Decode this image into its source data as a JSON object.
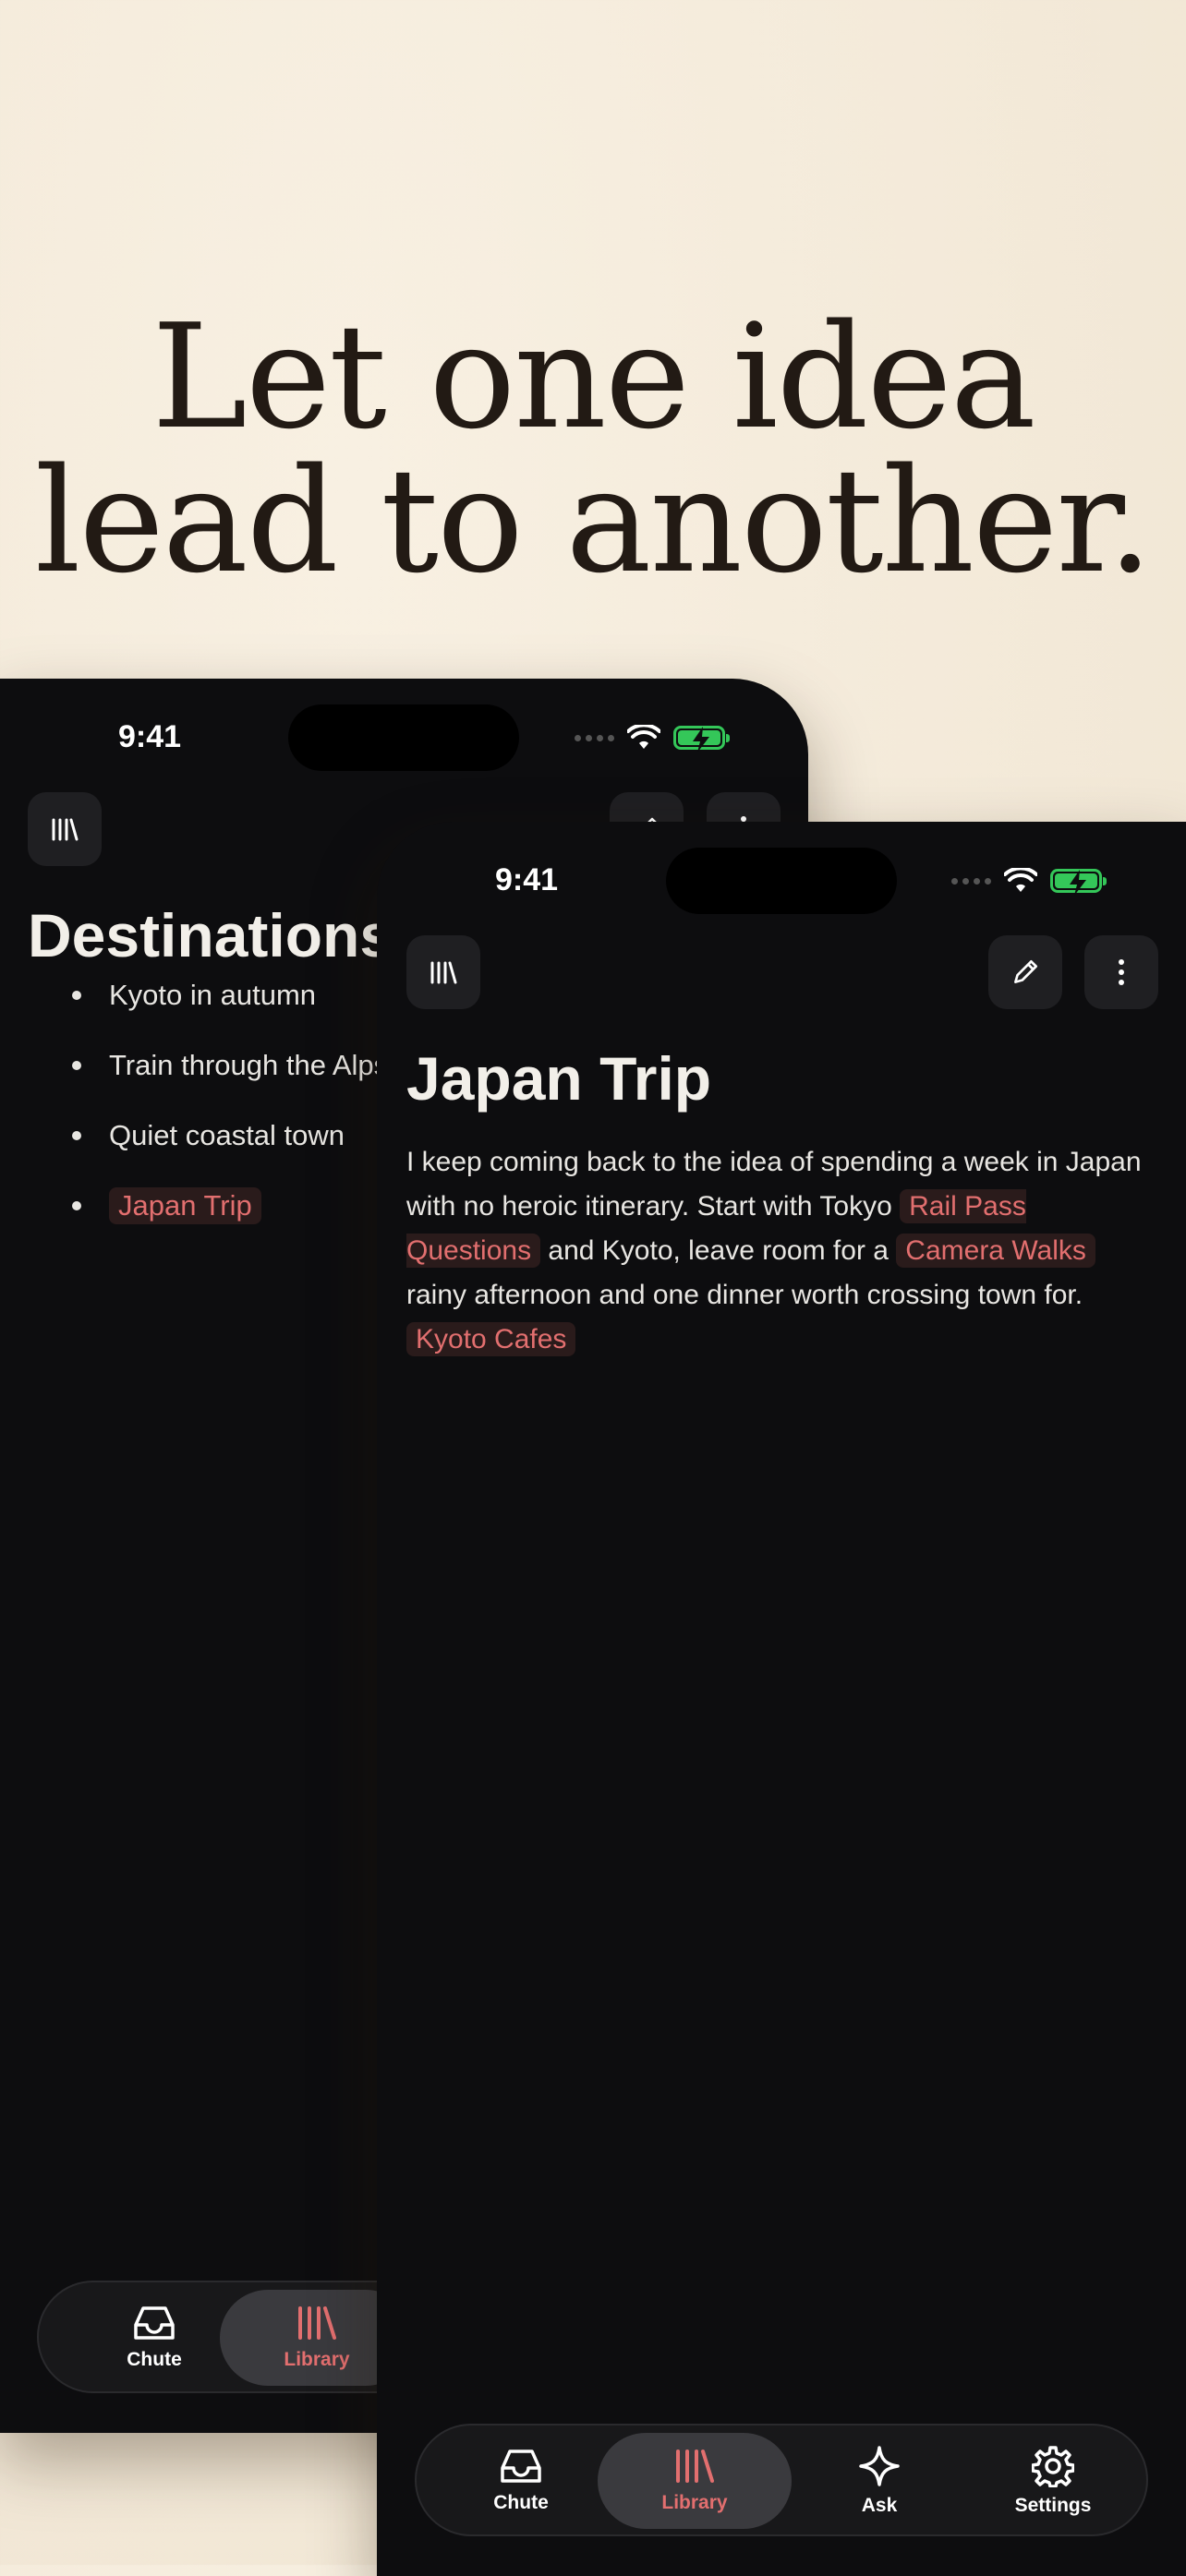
{
  "headline": {
    "line1": "Let one idea",
    "line2": "lead to another."
  },
  "back_phone": {
    "time": "9:41",
    "title": "Destinations",
    "items": [
      {
        "text": "Kyoto in autumn"
      },
      {
        "text": "Train through the Alps"
      },
      {
        "text": "Quiet coastal town"
      },
      {
        "text": "Japan Trip",
        "link": true
      }
    ],
    "tabs": [
      {
        "label": "Chute",
        "icon": "inbox-icon"
      },
      {
        "label": "Library",
        "icon": "library-icon",
        "active": true
      }
    ]
  },
  "front_phone": {
    "time": "9:41",
    "title": "Japan Trip",
    "body": {
      "t1": "I keep coming back to the idea of spending a week in Japan with no heroic itinerary. Start with Tokyo ",
      "link1": "Rail Pass Questions",
      "t2": " and Kyoto, leave room for a ",
      "link2": "Camera Walks",
      "t3": " rainy afternoon and one dinner worth crossing town for. ",
      "link3": "Kyoto Cafes"
    },
    "tabs": [
      {
        "label": "Chute",
        "icon": "inbox-icon"
      },
      {
        "label": "Library",
        "icon": "library-icon",
        "active": true
      },
      {
        "label": "Ask",
        "icon": "sparkle-icon"
      },
      {
        "label": "Settings",
        "icon": "gear-icon"
      }
    ]
  },
  "colors": {
    "accent": "#e26f6f",
    "battery": "#34c759",
    "background": "#f5ecdc",
    "phone": "#0d0d0f"
  }
}
